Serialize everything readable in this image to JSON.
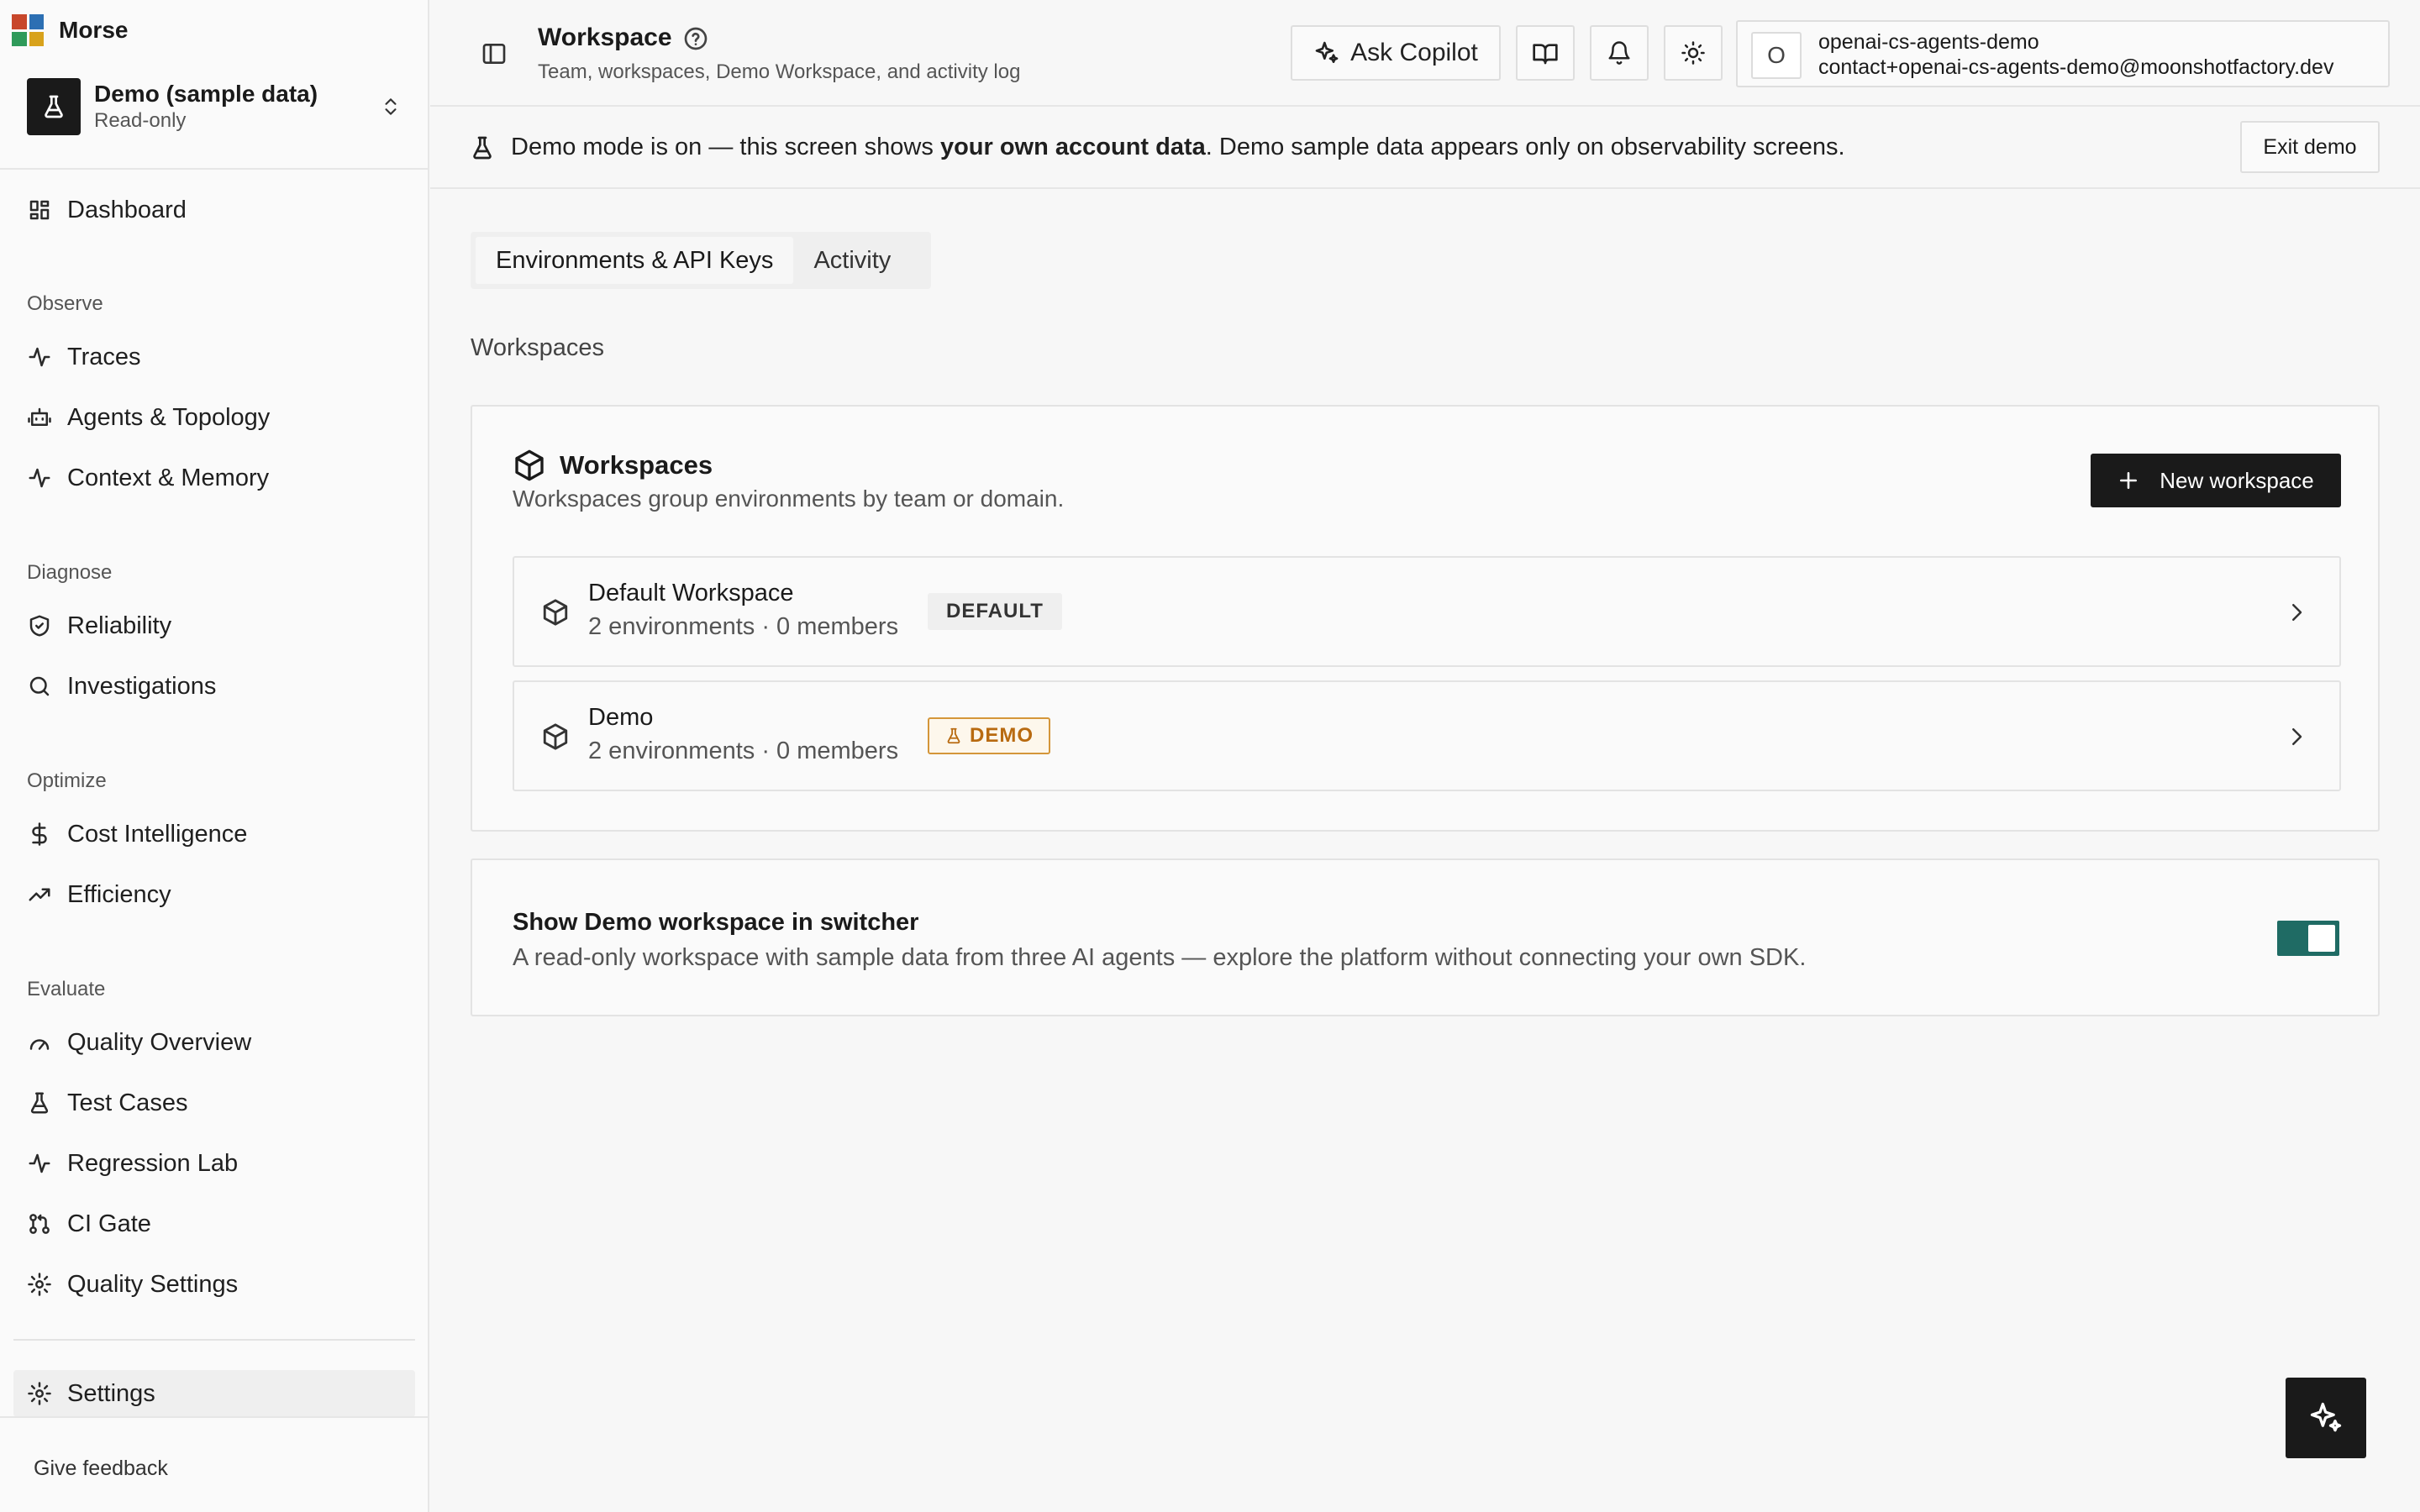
{
  "app": {
    "name": "Morse",
    "logo_colors": [
      "#c8472b",
      "#2c6fb3",
      "#2f9a5a",
      "#d8a21c"
    ]
  },
  "workspace_switcher": {
    "name": "Demo (sample data)",
    "mode": "Read-only",
    "icon": "flask-icon"
  },
  "sidebar": {
    "dashboard": "Dashboard",
    "sections": {
      "observe": "Observe",
      "diagnose": "Diagnose",
      "optimize": "Optimize",
      "evaluate": "Evaluate"
    },
    "items": {
      "traces": "Traces",
      "agents": "Agents & Topology",
      "context": "Context & Memory",
      "reliability": "Reliability",
      "investigations": "Investigations",
      "cost": "Cost Intelligence",
      "efficiency": "Efficiency",
      "quality_overview": "Quality Overview",
      "test_cases": "Test Cases",
      "regression_lab": "Regression Lab",
      "ci_gate": "CI Gate",
      "quality_settings": "Quality Settings",
      "settings": "Settings"
    },
    "active": "settings",
    "feedback": "Give feedback"
  },
  "header": {
    "title": "Workspace",
    "subtitle": "Team, workspaces, Demo Workspace, and activity log",
    "copilot_label": "Ask Copilot",
    "account": {
      "avatar_letter": "O",
      "name": "openai-cs-agents-demo",
      "email": "contact+openai-cs-agents-demo@moonshotfactory.dev"
    }
  },
  "banner": {
    "text_before": "Demo mode is on — this screen shows ",
    "text_bold": "your own account data",
    "text_after": ". Demo sample data appears only on observability screens.",
    "exit_label": "Exit demo"
  },
  "tabs": [
    {
      "label": "Environments & API Keys",
      "active": true
    },
    {
      "label": "Activity",
      "active": false
    }
  ],
  "section_label": "Workspaces",
  "workspaces_card": {
    "title": "Workspaces",
    "description": "Workspaces group environments by team or domain.",
    "new_button": "New workspace",
    "rows": [
      {
        "name": "Default Workspace",
        "meta": "2 environments · 0 members",
        "tag": "DEFAULT"
      },
      {
        "name": "Demo",
        "meta": "2 environments · 0 members",
        "tag": "DEMO"
      }
    ]
  },
  "demo_toggle": {
    "title": "Show Demo workspace in switcher",
    "description": "A read-only workspace with sample data from three AI agents — explore the platform without connecting your own SDK.",
    "enabled": true,
    "color": "#1f6b64"
  }
}
